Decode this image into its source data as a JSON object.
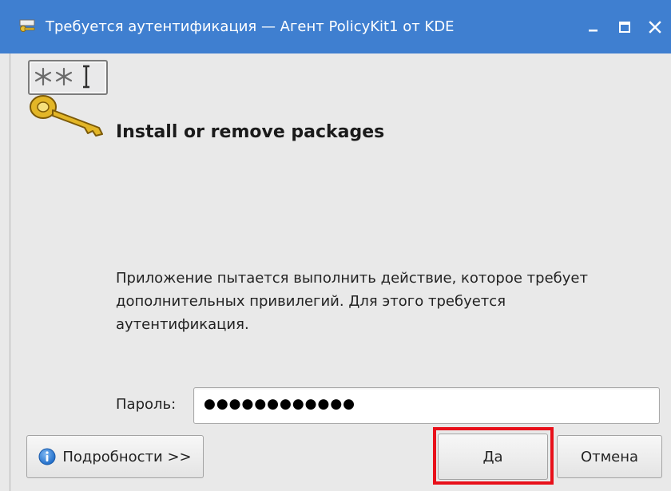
{
  "window": {
    "title": "Требуется аутентификация — Агент PolicyKit1 от KDE",
    "controls": [
      "minimize",
      "maximize",
      "close"
    ]
  },
  "dialog": {
    "heading": "Install or remove packages",
    "message": "Приложение пытается выполнить действие, которое требует дополнительных привилегий. Для этого требуется аутентификация.",
    "password_label": "Пароль:",
    "password_mask": "●●●●●●●●●●●●",
    "password_length": 12
  },
  "buttons": {
    "details_label": "Подробности >>",
    "ok_label": "Да",
    "cancel_label": "Отмена"
  },
  "icons": {
    "app": "keys-icon",
    "details": "info-icon"
  },
  "colors": {
    "titlebar": "#3f7fd0",
    "highlight": "#e8101a",
    "info": "#2d7ed6"
  }
}
